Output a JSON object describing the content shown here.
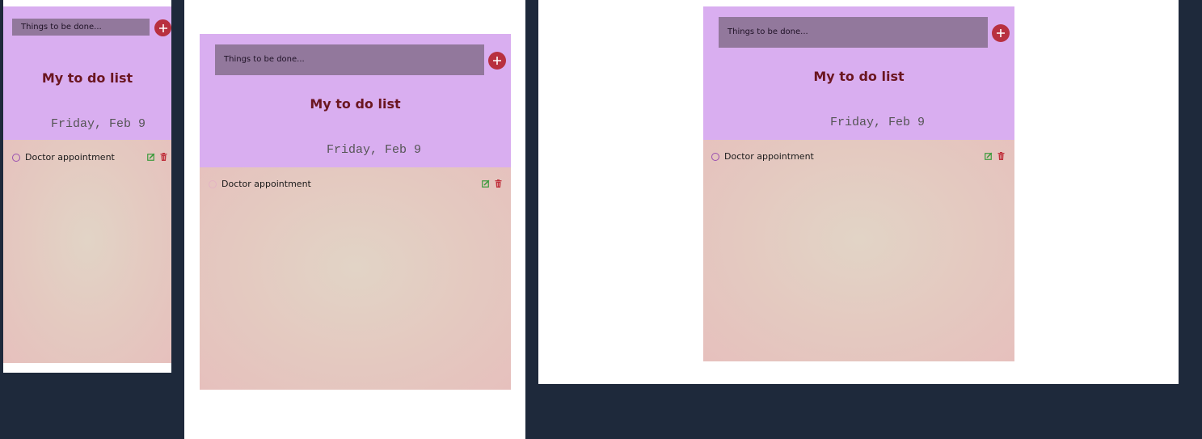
{
  "todo_app": {
    "input_placeholder": "Things to be done...",
    "title": "My to do list",
    "date": "Friday, Feb 9",
    "items": [
      {
        "label": "Doctor appointment"
      }
    ],
    "icons": {
      "add": "plus-circle-icon",
      "edit": "edit-icon",
      "delete": "trash-icon",
      "status": "circle-checkbox-icon"
    }
  },
  "colors": {
    "page_background": "#1e293b",
    "frame_background": "#ffffff",
    "header": "#d9aef0",
    "input": "#92789c",
    "add_button": "#b8303f",
    "title": "#6b1620",
    "edit_icon": "#3a9a3a",
    "delete_icon": "#c0303c"
  }
}
